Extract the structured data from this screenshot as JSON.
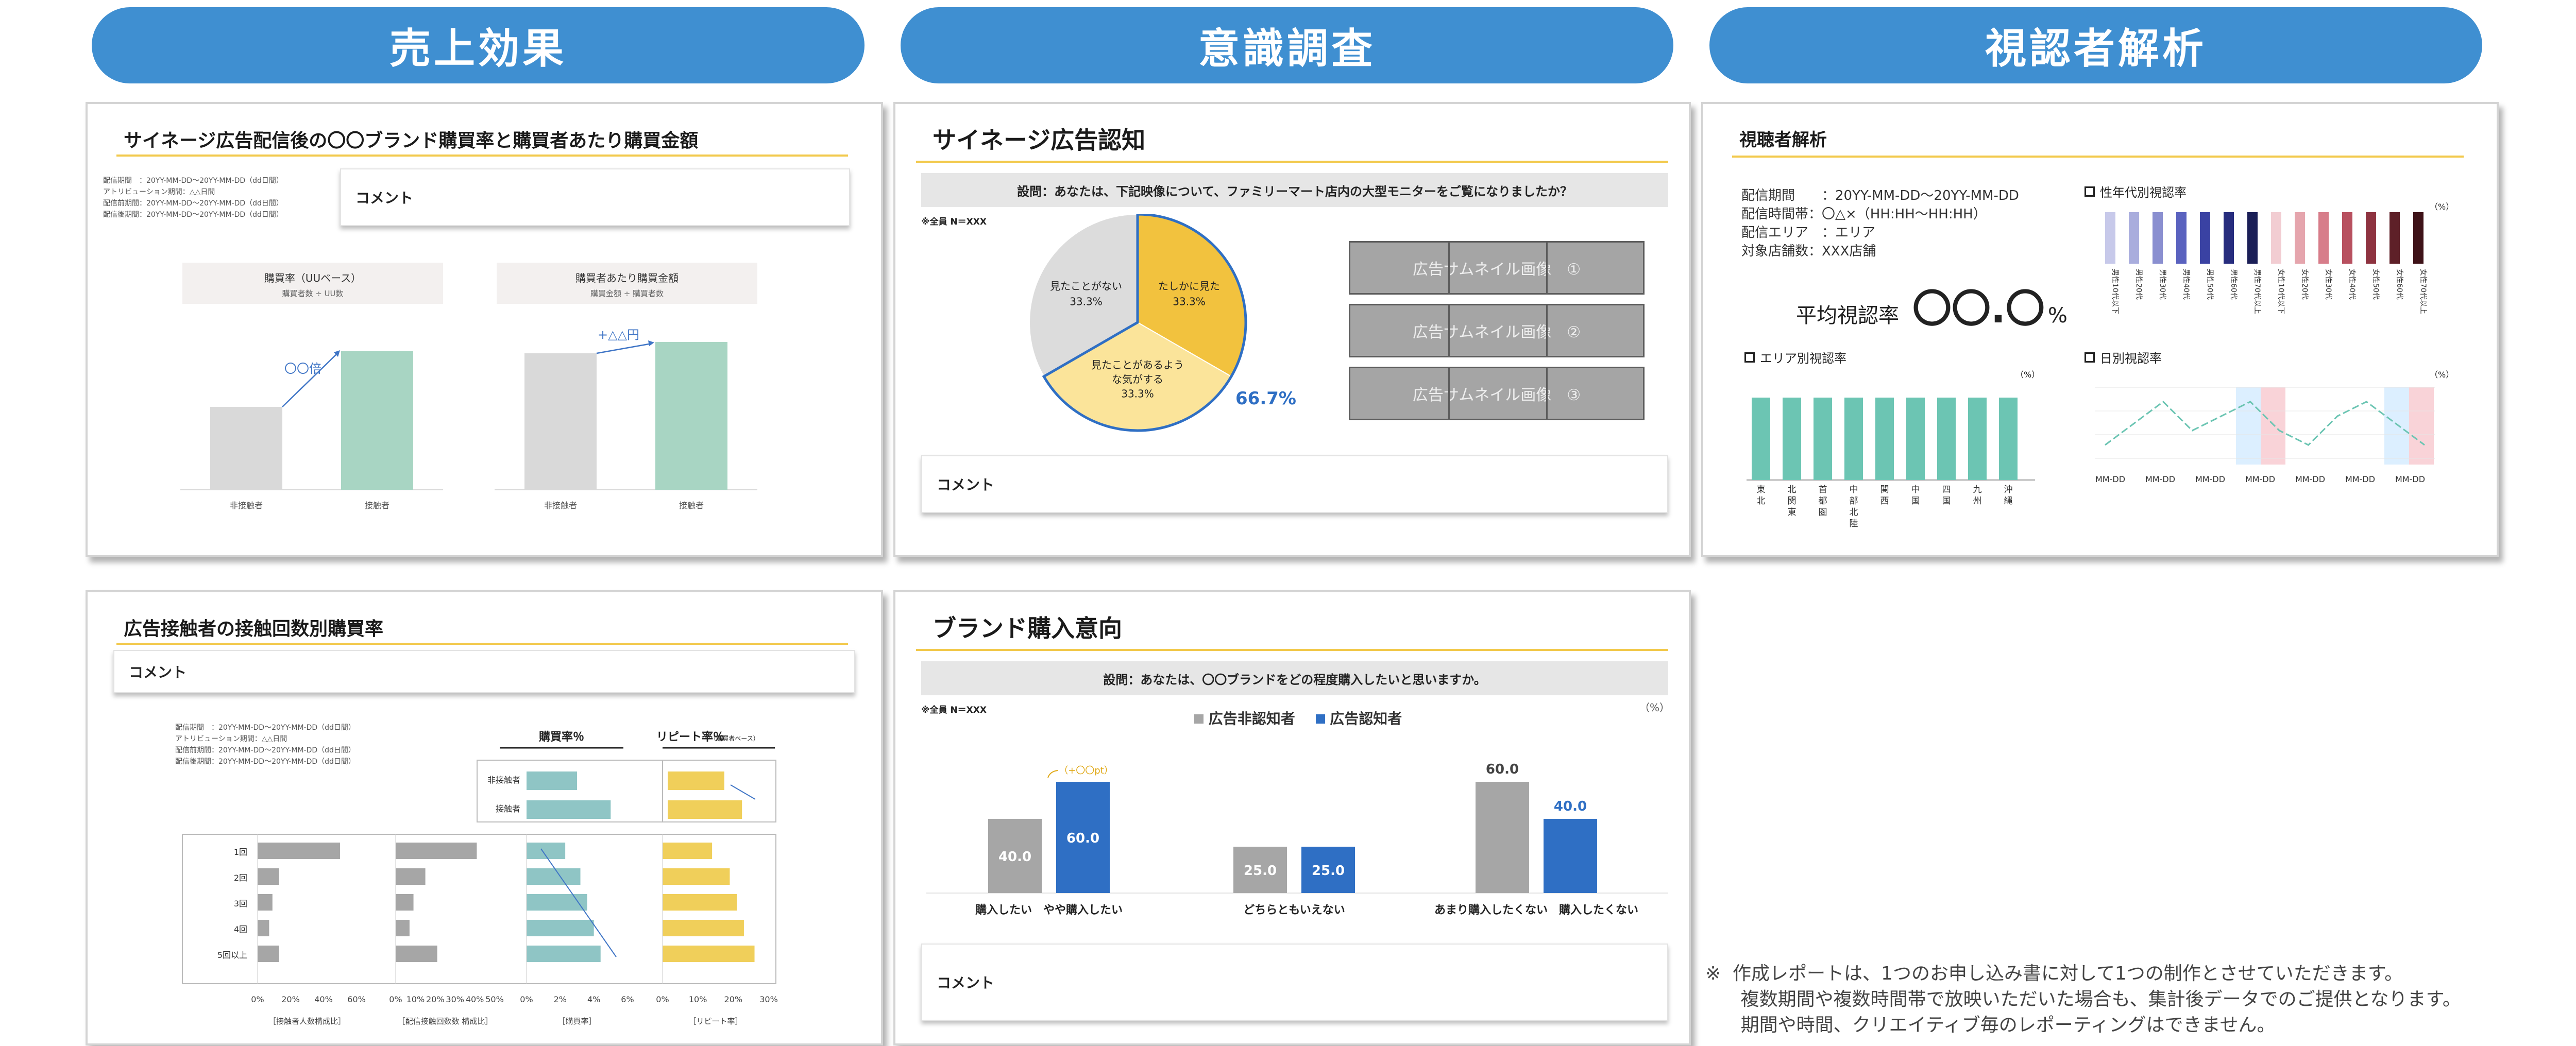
{
  "headers": [
    "売上効果",
    "意識調査",
    "視認者解析"
  ],
  "card1": {
    "title": "サイネージ広告配信後の〇〇ブランド購買率と購買者あたり購買金額",
    "periods": [
      "配信期間　：20YY-MM-DD〜20YY-MM-DD（dd日間）",
      "アトリビューション期間：△△日間",
      "配信前期間：20YY-MM-DD〜20YY-MM-DD（dd日間）",
      "配信後期間：20YY-MM-DD〜20YY-MM-DD（dd日間）"
    ],
    "comment": "コメント",
    "left_title": "購買率（UUベース）",
    "left_sub": "購買者数 ÷ UU数",
    "right_title": "購買者あたり購買金額",
    "right_sub": "購買金額 ÷ 購買者数",
    "left_ann": "〇〇倍",
    "right_ann": "+△△円",
    "x_labels": [
      "非接触者",
      "接触者"
    ]
  },
  "card2": {
    "title": "サイネージ広告認知",
    "question": "設問：あなたは、下記映像について、ファミリーマート店内の大型モニターをご覧になりましたか？",
    "n_label": "※全員 N＝XXX",
    "callout": "66.7%",
    "thumbs": [
      "広告サムネイル画像　①",
      "広告サムネイル画像　②",
      "広告サムネイル画像　③"
    ],
    "comment": "コメント"
  },
  "card3": {
    "title": "視聴者解析",
    "info": [
      "配信期間　　：20YY-MM-DD〜20YY-MM-DD",
      "配信時間帯：〇△×（HH:HH〜HH:HH）",
      "配信エリア　：エリア",
      "対象店舗数：XXX店舗"
    ],
    "avg_label": "平均視認率",
    "avg_value": "〇〇.〇",
    "avg_unit": "%",
    "age_title": "性年代別視認率",
    "area_title": "エリア別視認率",
    "day_title": "日別視認率",
    "pct": "（%）",
    "age_labels": [
      "男性10代以下",
      "男性20代",
      "男性30代",
      "男性40代",
      "男性50代",
      "男性60代",
      "男性70代以上",
      "女性10代以下",
      "女性20代",
      "女性30代",
      "女性40代",
      "女性50代",
      "女性60代",
      "女性70代以上"
    ],
    "area_labels": [
      "東北",
      "北関東",
      "首都圏",
      "中部北陸",
      "関西",
      "中国",
      "四国",
      "九州",
      "沖縄"
    ],
    "day_labels": [
      "MM-DD",
      "MM-DD",
      "MM-DD",
      "MM-DD",
      "MM-DD",
      "MM-DD",
      "MM-DD"
    ]
  },
  "card4": {
    "title": "広告接触者の接触回数別購買率",
    "comment": "コメント",
    "periods": [
      "配信期間　：20YY-MM-DD〜20YY-MM-DD（dd日間）",
      "アトリビューション期間：△△日間",
      "配信前期間：20YY-MM-DD〜20YY-MM-DD（dd日間）",
      "配信後期間：20YY-MM-DD〜20YY-MM-DD（dd日間）"
    ],
    "col_buy": "購買率％",
    "col_repeat": "リピート率％",
    "col_repeat_sub": "（購買者ベース）",
    "top_rows": [
      "非接触者",
      "接触者"
    ],
    "rows": [
      "1回",
      "2回",
      "3回",
      "4回",
      "5回以上"
    ],
    "axis1": [
      "0%",
      "20%",
      "40%",
      "60%"
    ],
    "axis2": [
      "0%",
      "10%",
      "20%",
      "30%",
      "40%",
      "50%"
    ],
    "axis3": [
      "0%",
      "2%",
      "4%",
      "6%"
    ],
    "axis4": [
      "0%",
      "10%",
      "20%",
      "30%"
    ],
    "foot": [
      "［接触者人数構成比］",
      "［配信接触回数数 構成比］",
      "［購買率］",
      "［リピート率］"
    ]
  },
  "card5": {
    "title": "ブランド購入意向",
    "question": "設問：あなたは、〇〇ブランドをどの程度購入したいと思いますか。",
    "n_label": "※全員 N＝XXX",
    "pct": "（%）",
    "legend": [
      "広告非認知者",
      "広告認知者"
    ],
    "annotation": "（+〇〇pt）",
    "comment": "コメント"
  },
  "footnote": "※  作成レポートは、1つのお申し込み書に対して1つの制作とさせていただきます。\n      複数期間や複数時間帯で放映いただいた場合も、集計後データでのご提供となります。\n      期間や時間、クリエイティブ毎のレポーティングはできません。",
  "chart_data": [
    {
      "type": "pie",
      "categories": [
        "たしかに見た",
        "見たことがあるような気がする",
        "見たことがない"
      ],
      "values": [
        33.3,
        33.3,
        33.3
      ],
      "labels": [
        "33.3%",
        "33.3%",
        "33.3%"
      ],
      "colors": [
        "#f2c23e",
        "#fbe49a",
        "#dcdcdc"
      ]
    },
    {
      "type": "bar",
      "categories": [
        "購入したい　やや購入したい",
        "どちらともいえない",
        "あまり購入したくない　購入したくない"
      ],
      "series": [
        {
          "name": "広告非認知者",
          "values": [
            40.0,
            25.0,
            60.0
          ],
          "color": "#a6a6a6"
        },
        {
          "name": "広告認知者",
          "values": [
            60.0,
            25.0,
            40.0
          ],
          "color": "#2f6fc4"
        }
      ],
      "ylim": [
        0,
        70
      ]
    },
    {
      "type": "bar",
      "title": "購買率（UUベース）",
      "categories": [
        "非接触者",
        "接触者"
      ],
      "values": [
        1.0,
        1.7
      ],
      "colors": [
        "#d9d9d9",
        "#a8d5c3"
      ]
    },
    {
      "type": "bar",
      "title": "購買者あたり購買金額",
      "categories": [
        "非接触者",
        "接触者"
      ],
      "values": [
        1.0,
        1.07
      ],
      "colors": [
        "#d9d9d9",
        "#a8d5c3"
      ]
    },
    {
      "type": "bar",
      "title": "性年代別視認率",
      "categories": [
        "男性10代以下",
        "男性20代",
        "男性30代",
        "男性40代",
        "男性50代",
        "男性60代",
        "男性70代以上",
        "女性10代以下",
        "女性20代",
        "女性30代",
        "女性40代",
        "女性50代",
        "女性60代",
        "女性70代以上"
      ],
      "values": [
        1,
        1,
        1,
        1,
        1,
        1,
        1,
        1,
        1,
        1,
        1,
        1,
        1,
        1
      ],
      "colors": [
        "#c7c9ea",
        "#a9addd",
        "#8a8fd0",
        "#5a62bf",
        "#3a42a3",
        "#272d7e",
        "#1b1f57",
        "#f2cdd2",
        "#e5a5ad",
        "#d77d8a",
        "#b8505f",
        "#8e3340",
        "#5e2028",
        "#3e1218"
      ]
    },
    {
      "type": "bar",
      "title": "エリア別視認率",
      "categories": [
        "東北",
        "北関東",
        "首都圏",
        "中部北陸",
        "関西",
        "中国",
        "四国",
        "九州",
        "沖縄"
      ],
      "values": [
        1,
        1,
        1,
        1,
        1,
        1,
        1,
        1,
        1
      ],
      "colors": [
        "#6cc5b3"
      ]
    },
    {
      "type": "line",
      "title": "日別視認率",
      "x": [
        "MM-DD",
        "MM-DD",
        "MM-DD",
        "MM-DD",
        "MM-DD",
        "MM-DD",
        "MM-DD"
      ],
      "values": [
        0.2,
        0.5,
        0.8,
        0.4,
        0.6,
        0.8,
        0.4,
        0.2,
        0.6,
        0.8,
        0.5,
        0.2
      ],
      "colors": [
        "#6cc5b3"
      ]
    },
    {
      "type": "bar",
      "title": "広告接触者の接触回数別購買率",
      "categories": [
        "1回",
        "2回",
        "3回",
        "4回",
        "5回以上"
      ],
      "series": [
        {
          "name": "接触者人数構成比",
          "values": [
            50,
            13,
            9,
            7,
            13
          ]
        },
        {
          "name": "配信接触回数数 構成比",
          "values": [
            41,
            15,
            9,
            7,
            21
          ]
        },
        {
          "name": "購買率",
          "values": [
            2.3,
            3.2,
            3.6,
            4.0,
            4.4
          ]
        },
        {
          "name": "リピート率",
          "values": [
            14,
            19,
            21,
            23,
            26
          ]
        }
      ]
    },
    {
      "type": "bar",
      "categories": [
        "非接触者",
        "接触者"
      ],
      "series": [
        {
          "name": "購買率",
          "values": [
            3.0,
            5.0
          ]
        },
        {
          "name": "リピート率",
          "values": [
            16,
            21
          ]
        }
      ]
    }
  ]
}
